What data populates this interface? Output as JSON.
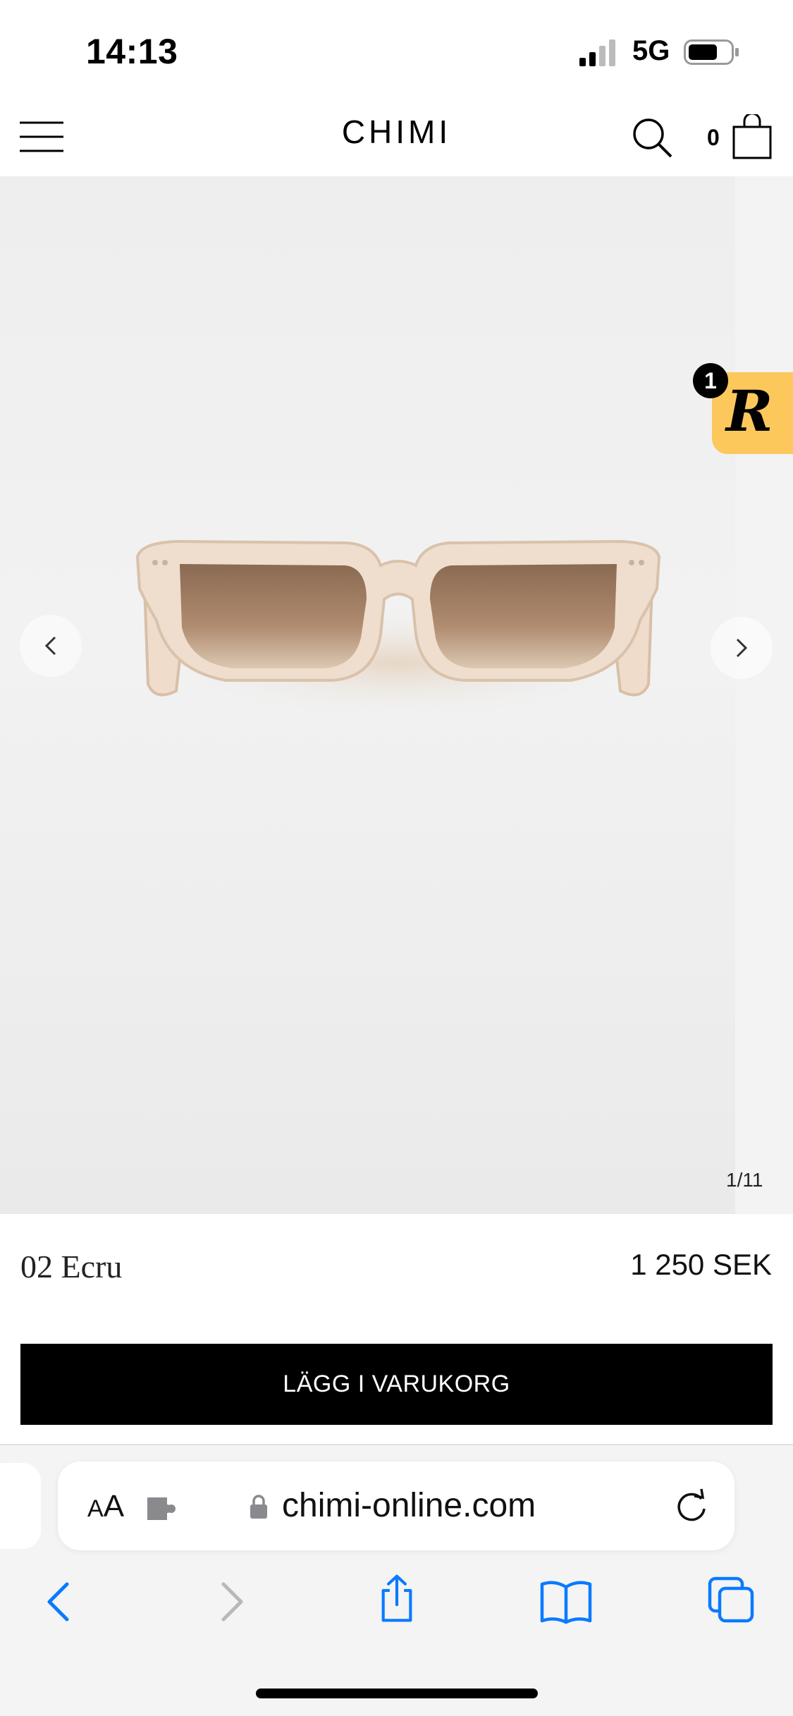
{
  "status_bar": {
    "time": "14:13",
    "network": "5G"
  },
  "header": {
    "brand": "CHIMI",
    "cart_count": "0",
    "icons": [
      "menu-icon",
      "search-icon",
      "shopping-bag-icon"
    ]
  },
  "gallery": {
    "counter": "1/11",
    "image": "sunglasses-ecru",
    "icons": [
      "chevron-left-icon",
      "chevron-right-icon"
    ]
  },
  "reward_widget": {
    "letter": "R",
    "notification_count": "1",
    "color": "#fcc85c"
  },
  "product": {
    "name": "02 Ecru",
    "price": "1 250 SEK",
    "add_to_cart_label": "LÄGG I VARUKORG"
  },
  "browser": {
    "text_size_label_small": "A",
    "text_size_label_large": "A",
    "url": "chimi-online.com",
    "accent_color": "#0a7aff",
    "icons": [
      "extension-icon",
      "lock-icon",
      "reload-icon",
      "back-icon",
      "forward-icon",
      "share-icon",
      "bookmarks-icon",
      "tabs-icon"
    ]
  }
}
